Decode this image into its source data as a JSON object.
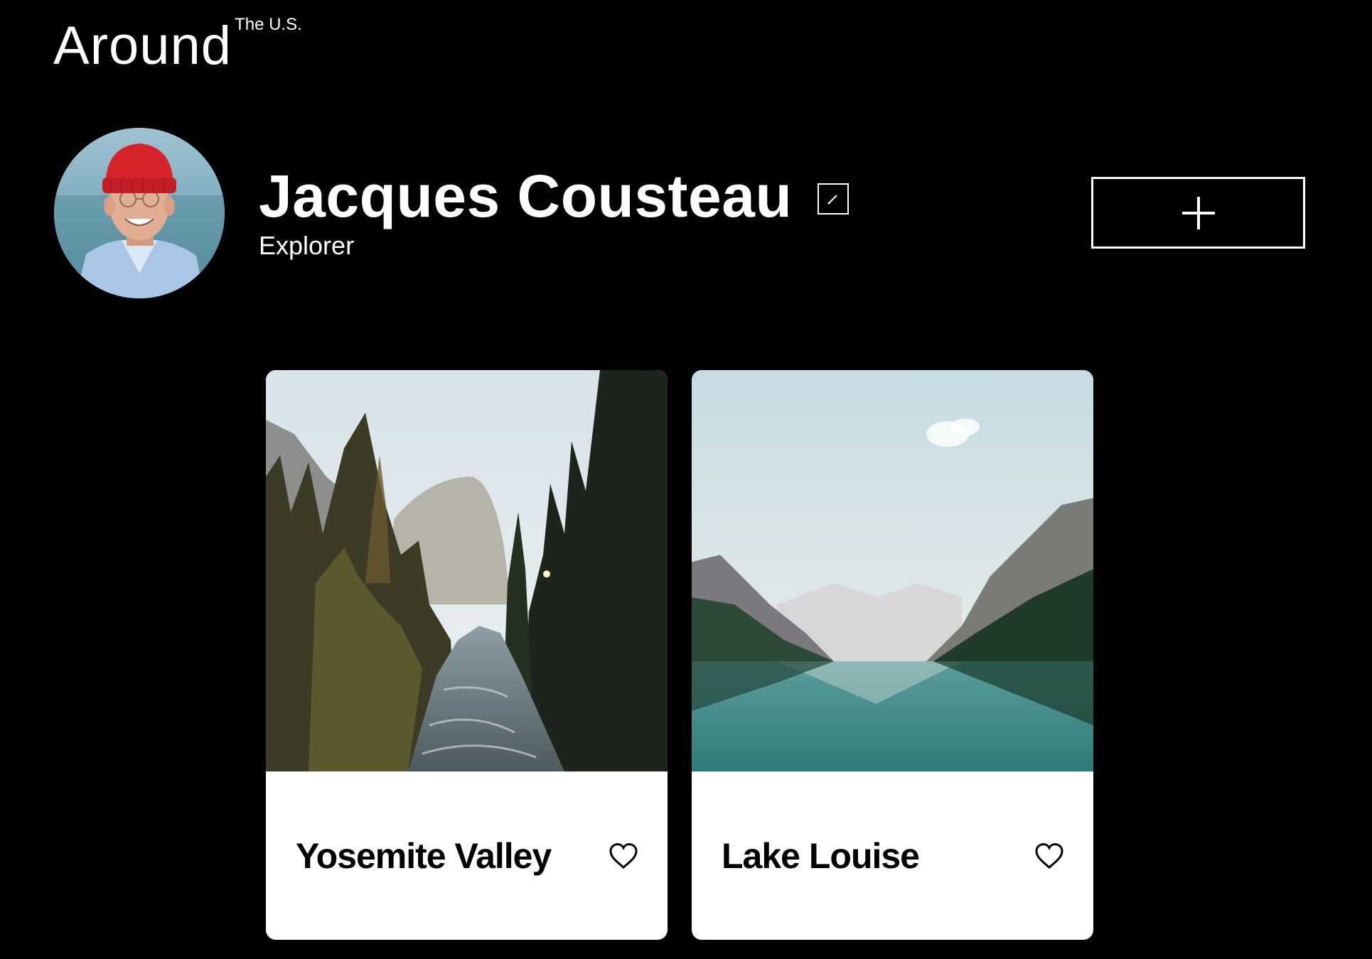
{
  "header": {
    "logo_main": "Around",
    "logo_sup": "The U.S."
  },
  "profile": {
    "name": "Jacques Cousteau",
    "role": "Explorer",
    "avatar_icon": "avatar-photo",
    "edit_icon": "pencil-icon"
  },
  "toolbar": {
    "add_icon": "plus-icon"
  },
  "cards": [
    {
      "title": "Yosemite Valley",
      "like_icon": "heart-outline-icon"
    },
    {
      "title": "Lake Louise",
      "like_icon": "heart-outline-icon"
    }
  ],
  "colors": {
    "background": "#000000",
    "text": "#ffffff",
    "card_bg": "#ffffff",
    "card_text": "#000000"
  }
}
